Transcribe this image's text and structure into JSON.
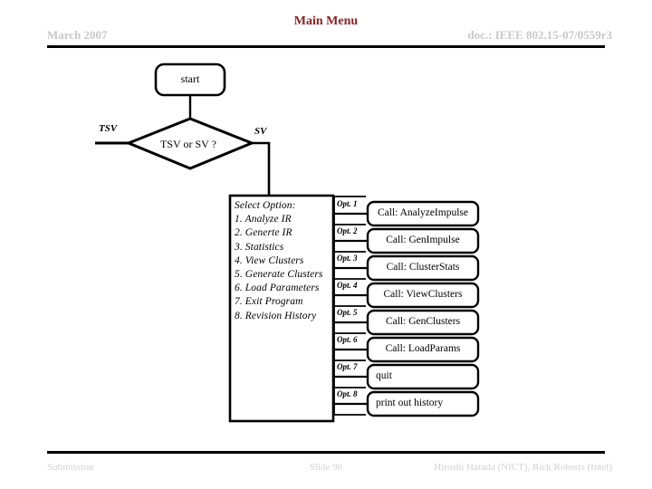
{
  "header": {
    "date": "March 2007",
    "title": "Main Menu",
    "doc": "doc.: IEEE 802.15-07/0559r3",
    "title_color": "#8a2222",
    "meta_color": "#c8c8c8"
  },
  "footer": {
    "left": "Submission",
    "center": "Slide 98",
    "right": "Hiroshi Harada (NICT), Rick Roberts (Intel)",
    "color": "#d2d2d2"
  },
  "flowchart": {
    "start_node": "start",
    "decision_node": "TSV or SV ?",
    "branch_left": "TSV",
    "branch_right": "SV",
    "option_list": [
      "Select Option:",
      "1. Analyze IR",
      "2. Generte IR",
      "3. Statistics",
      "4. View Clusters",
      "5. Generate Clusters",
      "6. Load Parameters",
      "7. Exit Program",
      "8. Revision History"
    ],
    "branches": [
      {
        "tag": "Opt. 1",
        "call": "Call: AnalyzeImpulse",
        "align": "center"
      },
      {
        "tag": "Opt. 2",
        "call": "Call: GenImpulse",
        "align": "center"
      },
      {
        "tag": "Opt. 3",
        "call": "Call: ClusterStats",
        "align": "center"
      },
      {
        "tag": "Opt. 4",
        "call": "Call: ViewClusters",
        "align": "center"
      },
      {
        "tag": "Opt. 5",
        "call": "Call: GenClusters",
        "align": "center"
      },
      {
        "tag": "Opt. 6",
        "call": "Call: LoadParams",
        "align": "center"
      },
      {
        "tag": "Opt. 7",
        "call": "quit",
        "align": "left"
      },
      {
        "tag": "Opt. 8",
        "call": "print out history",
        "align": "left"
      }
    ],
    "stroke_color": "#000000",
    "fill_color": "#ffffff"
  }
}
